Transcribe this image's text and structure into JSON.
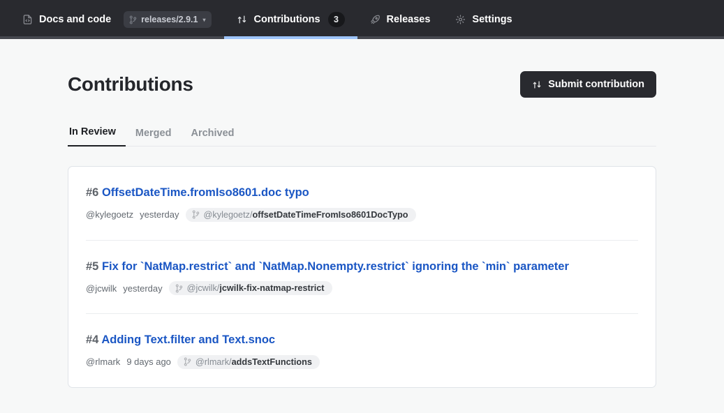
{
  "header": {
    "nav": [
      {
        "id": "docs-and-code",
        "icon": "file-code-icon",
        "label": "Docs and code",
        "active": false
      },
      {
        "id": "contributions",
        "icon": "pull-request-icon",
        "label": "Contributions",
        "active": true,
        "count": "3"
      },
      {
        "id": "releases",
        "icon": "rocket-icon",
        "label": "Releases",
        "active": false
      },
      {
        "id": "settings",
        "icon": "gear-icon",
        "label": "Settings",
        "active": false
      }
    ],
    "branch_selector": {
      "icon": "git-branch-icon",
      "label": "releases/2.9.1",
      "caret": "▾"
    },
    "active_underline_color": "#9dc4fb",
    "background_color": "#292a2f"
  },
  "main": {
    "title": "Contributions",
    "submit_button": {
      "icon": "pull-request-icon",
      "label": "Submit contribution"
    },
    "tabs": [
      {
        "id": "in-review",
        "label": "In Review",
        "active": true
      },
      {
        "id": "merged",
        "label": "Merged",
        "active": false
      },
      {
        "id": "archived",
        "label": "Archived",
        "active": false
      }
    ],
    "contributions": [
      {
        "number": "#6",
        "title": "OffsetDateTime.fromIso8601.doc typo",
        "author": "@kylegoetz",
        "time": "yesterday",
        "branch_owner": "@kylegoetz/",
        "branch_name": "offsetDateTimeFromIso8601DocTypo"
      },
      {
        "number": "#5",
        "title": "Fix for `NatMap.restrict` and `NatMap.Nonempty.restrict` ignoring the `min` parameter",
        "author": "@jcwilk",
        "time": "yesterday",
        "branch_owner": "@jcwilk/",
        "branch_name": "jcwilk-fix-natmap-restrict"
      },
      {
        "number": "#4",
        "title": "Adding Text.filter and Text.snoc",
        "author": "@rlmark",
        "time": "9 days ago",
        "branch_owner": "@rlmark/",
        "branch_name": "addsTextFunctions"
      }
    ]
  },
  "colors": {
    "link": "#1a56c4",
    "page_background": "#f7f8f8",
    "card_background": "#ffffff",
    "card_border": "#dfe3e8"
  }
}
